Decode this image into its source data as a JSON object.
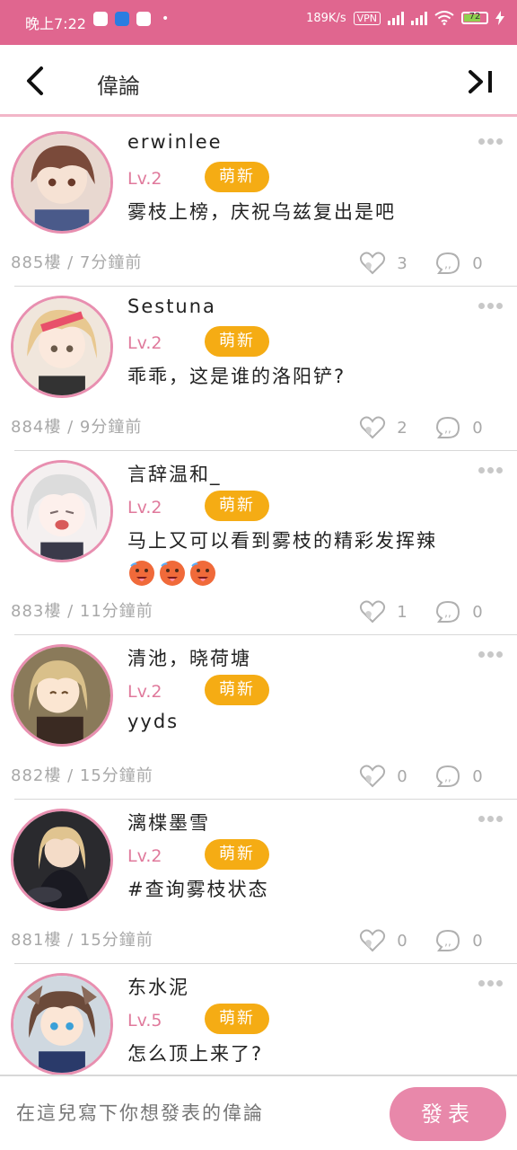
{
  "statusbar": {
    "time": "晚上7:22",
    "speed": "189K/s",
    "vpn": "VPN",
    "battery": "72"
  },
  "header": {
    "title": "偉論",
    "back_icon": "chevron-left-icon",
    "last_icon": "skip-to-end-icon"
  },
  "posts": [
    {
      "name": "erwinlee",
      "level": "Lv.2",
      "tag": "萌新",
      "content": "雾枝上榜，庆祝乌兹复出是吧",
      "floor": "885樓",
      "time": "7分鐘前",
      "likes": "3",
      "comments": "0",
      "avatar_color": "#7a4a3a"
    },
    {
      "name": "Sestuna",
      "level": "Lv.2",
      "tag": "萌新",
      "content": "乖乖，这是谁的洛阳铲?",
      "floor": "884樓",
      "time": "9分鐘前",
      "likes": "2",
      "comments": "0",
      "avatar_color": "#e8c890"
    },
    {
      "name": "言辞温和_",
      "level": "Lv.2",
      "tag": "萌新",
      "content": "马上又可以看到雾枝的精彩发挥辣",
      "floor": "883樓",
      "time": "11分鐘前",
      "likes": "1",
      "comments": "0",
      "avatar_color": "#dcdcdc",
      "emoji": "hot-face-emoji"
    },
    {
      "name": "清池，晓荷塘",
      "level": "Lv.2",
      "tag": "萌新",
      "content": "yyds",
      "floor": "882樓",
      "time": "15分鐘前",
      "likes": "0",
      "comments": "0",
      "avatar_color": "#d9c08a"
    },
    {
      "name": "漓楪墨雪",
      "level": "Lv.2",
      "tag": "萌新",
      "content": "#查询雾枝状态",
      "floor": "881樓",
      "time": "15分鐘前",
      "likes": "0",
      "comments": "0",
      "avatar_color": "#5a4a40"
    },
    {
      "name": "东水泥",
      "level": "Lv.5",
      "tag": "萌新",
      "content": "怎么顶上来了?",
      "avatar_color": "#6b4a3a"
    }
  ],
  "separator": "/",
  "composer": {
    "placeholder": "在這兒寫下你想發表的偉論",
    "send_label": "發表"
  },
  "colors": {
    "accent": "#e0668f",
    "tag": "#f5ac14",
    "level": "#e07a9c"
  }
}
